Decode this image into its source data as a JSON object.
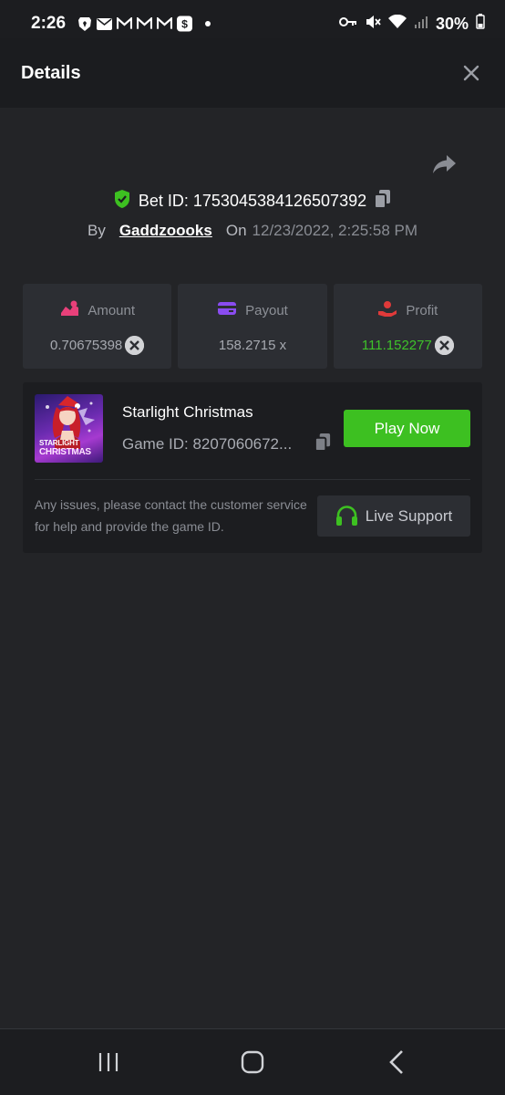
{
  "status_bar": {
    "time": "2:26",
    "battery": "30%",
    "icons_left": [
      "brave-icon",
      "mail-icon",
      "gmail-icon",
      "gmail-icon",
      "gmail-icon",
      "cash-app-icon"
    ],
    "icons_right": [
      "key-icon",
      "mute-icon",
      "wifi-icon",
      "signal-icon",
      "battery-icon"
    ]
  },
  "header": {
    "title": "Details"
  },
  "bet": {
    "bet_id_label": "Bet ID: 1753045384126507392",
    "by_label": "By",
    "username": "Gaddzoooks",
    "on_label": "On",
    "date": "12/23/2022, 2:25:58 PM"
  },
  "stats": [
    {
      "label": "Amount",
      "value": "0.70675398",
      "icon": "amount-icon",
      "color": "#e8407a"
    },
    {
      "label": "Payout",
      "value": "158.2715 x",
      "icon": "payout-icon",
      "color": "#8a4cf0"
    },
    {
      "label": "Profit",
      "value": "111.152277",
      "icon": "profit-icon",
      "color": "#e03a3a"
    }
  ],
  "game": {
    "name": "Starlight Christmas",
    "game_id": "Game ID: 8207060672...",
    "thumb_text_1": "STARLIGHT",
    "thumb_text_2": "CHRISTMAS",
    "play_label": "Play Now"
  },
  "support": {
    "text": "Any issues, please contact the customer service for help and provide the game ID.",
    "button_label": "Live Support"
  },
  "colors": {
    "background": "#232427",
    "card": "#2c2e33",
    "green": "#3dc021",
    "profit_green": "#3ec32a"
  }
}
